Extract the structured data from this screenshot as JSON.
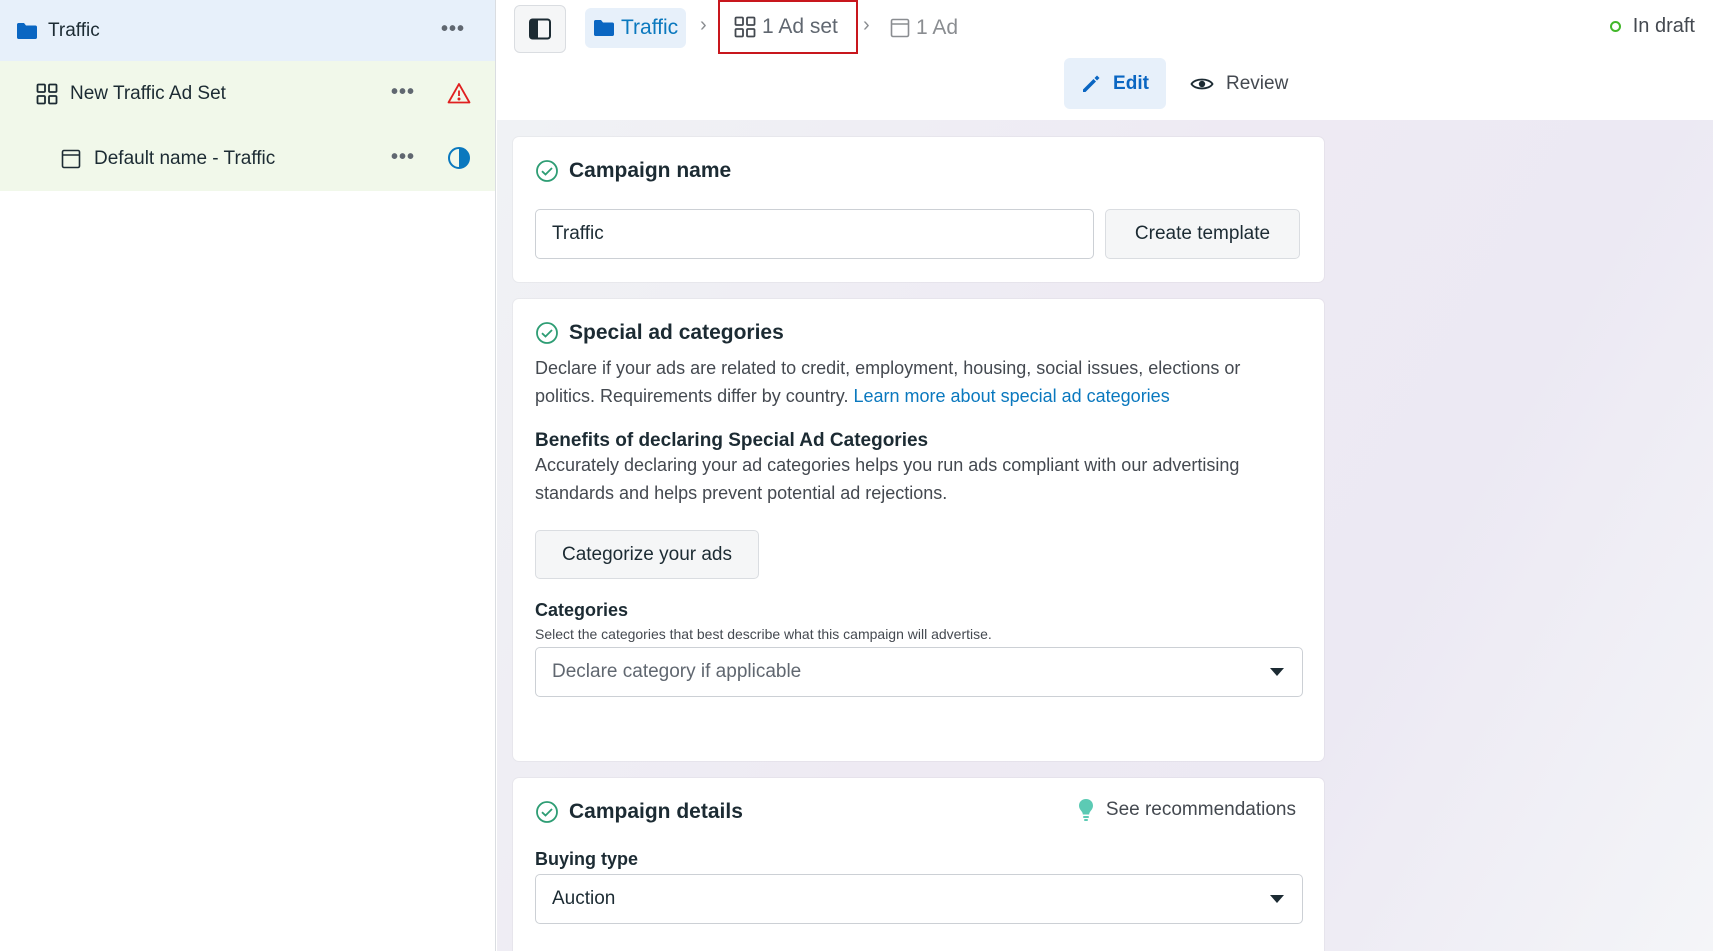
{
  "sidebar": {
    "campaign": {
      "label": "Traffic",
      "icon": "folder-icon"
    },
    "adset": {
      "label": "New Traffic Ad Set",
      "icon": "grid-icon",
      "status_icon": "warning-icon"
    },
    "ad": {
      "label": "Default name - Traffic",
      "icon": "ad-icon",
      "status_icon": "half-circle-icon"
    },
    "more_label": "•••"
  },
  "topbar": {
    "breadcrumbs": [
      {
        "label": "Traffic",
        "icon": "folder-icon"
      },
      {
        "label": "1 Ad set",
        "icon": "grid-icon"
      },
      {
        "label": "1 Ad",
        "icon": "ad-icon"
      }
    ],
    "separator": "›",
    "status": "In draft",
    "modes": {
      "edit": "Edit",
      "review": "Review"
    }
  },
  "campaign_name": {
    "title": "Campaign name",
    "value": "Traffic",
    "create_template": "Create template"
  },
  "special_categories": {
    "title": "Special ad categories",
    "description": "Declare if your ads are related to credit, employment, housing, social issues, elections or politics. Requirements differ by country.",
    "learn_more": "Learn more about special ad categories",
    "benefits_title": "Benefits of declaring Special Ad Categories",
    "benefits_text": "Accurately declaring your ad categories helps you run ads compliant with our advertising standards and helps prevent potential ad rejections.",
    "categorize_button": "Categorize your ads",
    "categories_label": "Categories",
    "categories_help": "Select the categories that best describe what this campaign will advertise.",
    "categories_placeholder": "Declare category if applicable"
  },
  "campaign_details": {
    "title": "Campaign details",
    "recommendations": "See recommendations",
    "buying_type_label": "Buying type",
    "buying_type_value": "Auction"
  },
  "colors": {
    "accent": "#0a78be",
    "selected_crumb_border": "#c8161d",
    "draft_dot": "#42b72a",
    "success_check": "#2e9d74",
    "warning": "#e02020"
  }
}
